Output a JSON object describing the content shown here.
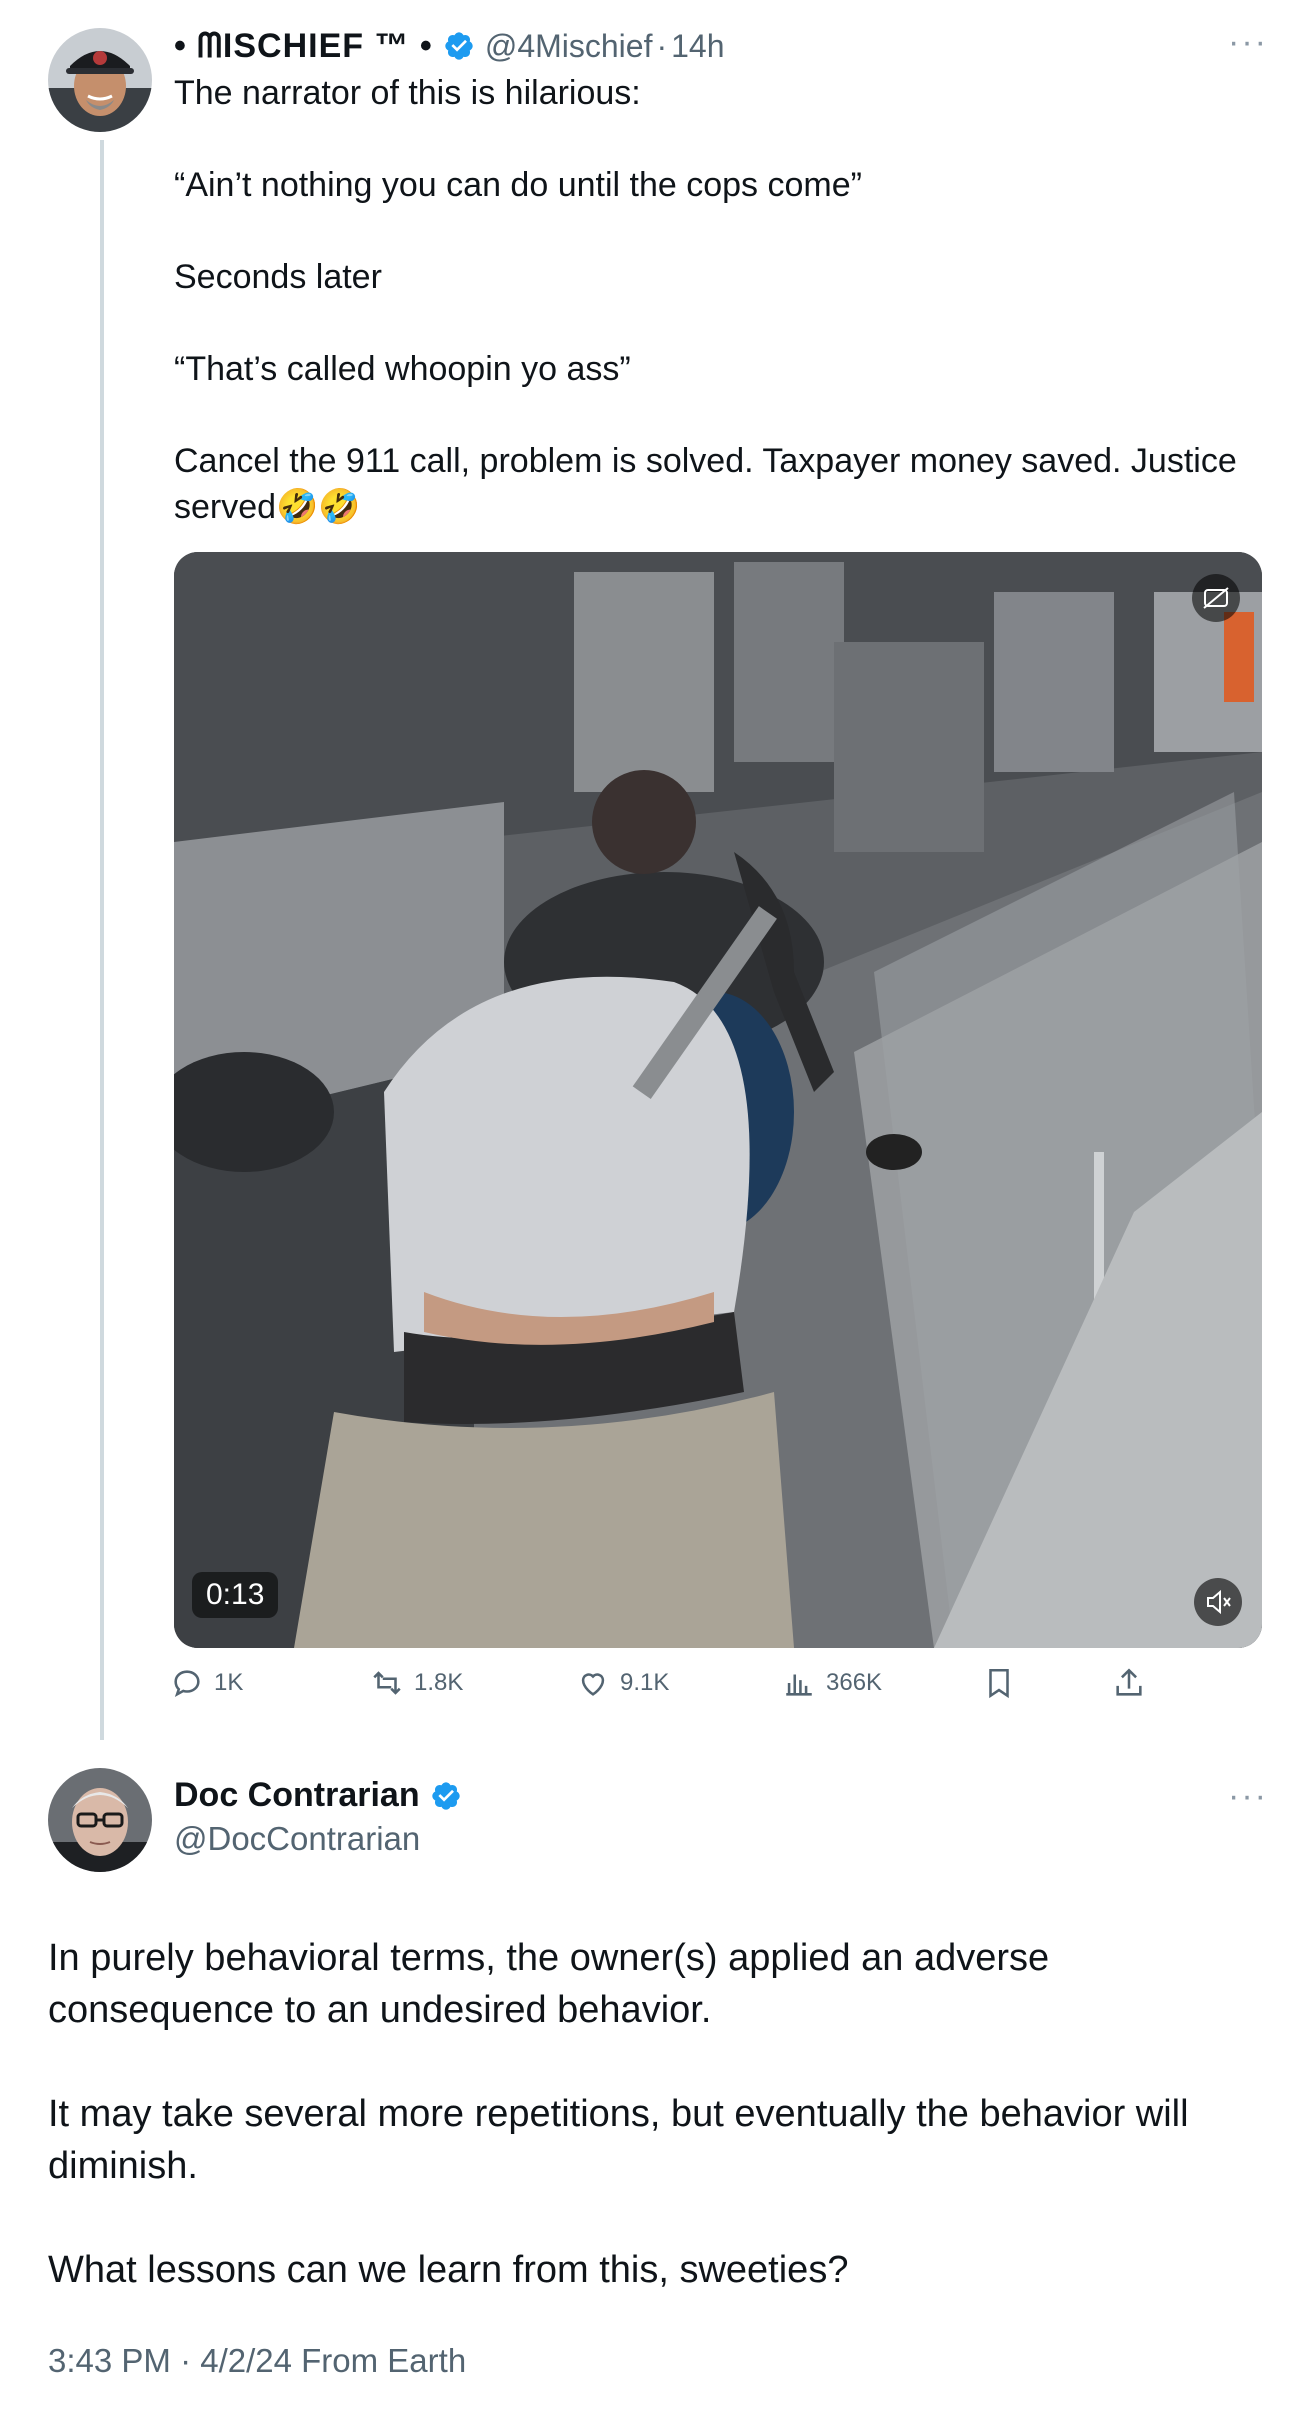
{
  "first_tweet": {
    "author_name": "• ᗰISCHIEF ™ •",
    "handle": "@4Mischief",
    "separator": "·",
    "time": "14h",
    "text_lines": [
      "The narrator of this is hilarious:",
      "“Ain’t nothing you can do until the cops come”",
      "Seconds later",
      "“That’s called whoopin yo ass”",
      "Cancel the 911 call, problem is solved. Taxpayer money saved. Justice served🤣🤣"
    ],
    "video": {
      "duration": "0:13"
    },
    "actions": {
      "replies": "1K",
      "reposts": "1.8K",
      "likes": "9.1K",
      "views": "366K"
    }
  },
  "second_tweet": {
    "author_name": "Doc Contrarian",
    "handle": "@DocContrarian",
    "text_paragraphs": [
      "In purely behavioral terms, the owner(s) applied an adverse consequence to an undesired behavior.",
      "It may take several more repetitions, but eventually the behavior will diminish.",
      "What lessons can we learn from this, sweeties?"
    ],
    "meta": "3:43 PM · 4/2/24 From Earth"
  },
  "colors": {
    "verified_blue": "#1d9bf0",
    "secondary_text": "#536471",
    "thread_line": "#cfd9de"
  },
  "icons": {
    "more": "more-horizontal-icon",
    "verified": "verified-badge-icon",
    "reply": "reply-icon",
    "repost": "repost-icon",
    "like": "heart-icon",
    "views": "views-icon",
    "bookmark": "bookmark-icon",
    "share": "share-icon",
    "mute": "muted-speaker-icon",
    "captions": "captions-icon"
  }
}
